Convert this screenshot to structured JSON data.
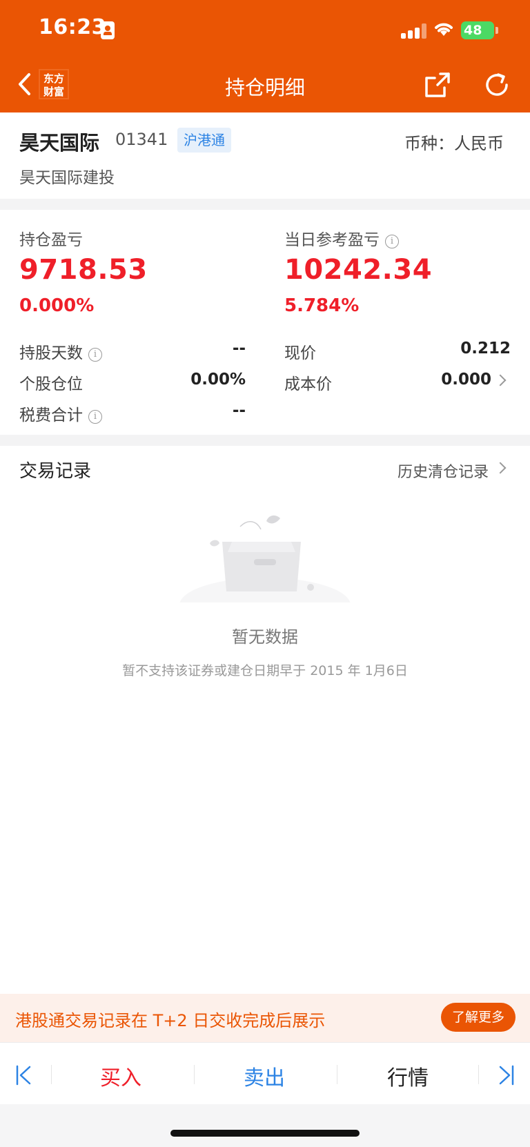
{
  "status_bar": {
    "time": "16:23",
    "battery": "48",
    "icons": [
      "contact-card-icon",
      "cellular-signal-icon",
      "wifi-icon",
      "battery-charging-icon"
    ]
  },
  "nav": {
    "logo_line1": "东方",
    "logo_line2": "财富",
    "title": "持仓明细",
    "icons": [
      "back-icon",
      "share-icon",
      "refresh-icon"
    ]
  },
  "stock": {
    "name": "昊天国际",
    "code": "01341",
    "market_tag": "沪港通",
    "currency": "币种：人民币",
    "full_name": "昊天国际建投"
  },
  "pnl": {
    "holding_label": "持仓盈亏",
    "holding_value": "9718.53",
    "holding_pct": "0.000%",
    "daily_label": "当日参考盈亏",
    "daily_value": "10242.34",
    "daily_pct": "5.784%"
  },
  "details": {
    "holding_days_label": "持股天数",
    "holding_days_value": "--",
    "position_label": "个股仓位",
    "position_value": "0.00%",
    "tax_label": "税费合计",
    "tax_value": "--",
    "price_label": "现价",
    "price_value": "0.212",
    "cost_label": "成本价",
    "cost_value": "0.000"
  },
  "trades": {
    "title": "交易记录",
    "history_link": "历史清仓记录",
    "empty_title": "暂无数据",
    "empty_sub": "暂不支持该证券或建仓日期早于 2015 年 1月6日"
  },
  "notice": {
    "text": "港股通交易记录在 T+2 日交收完成后展示",
    "button": "了解更多"
  },
  "actions": {
    "buy": "买入",
    "sell": "卖出",
    "quote": "行情"
  },
  "colors": {
    "brand_orange": "#ea5504",
    "gain_red": "#ef1f29",
    "sell_blue": "#2c83e4"
  }
}
